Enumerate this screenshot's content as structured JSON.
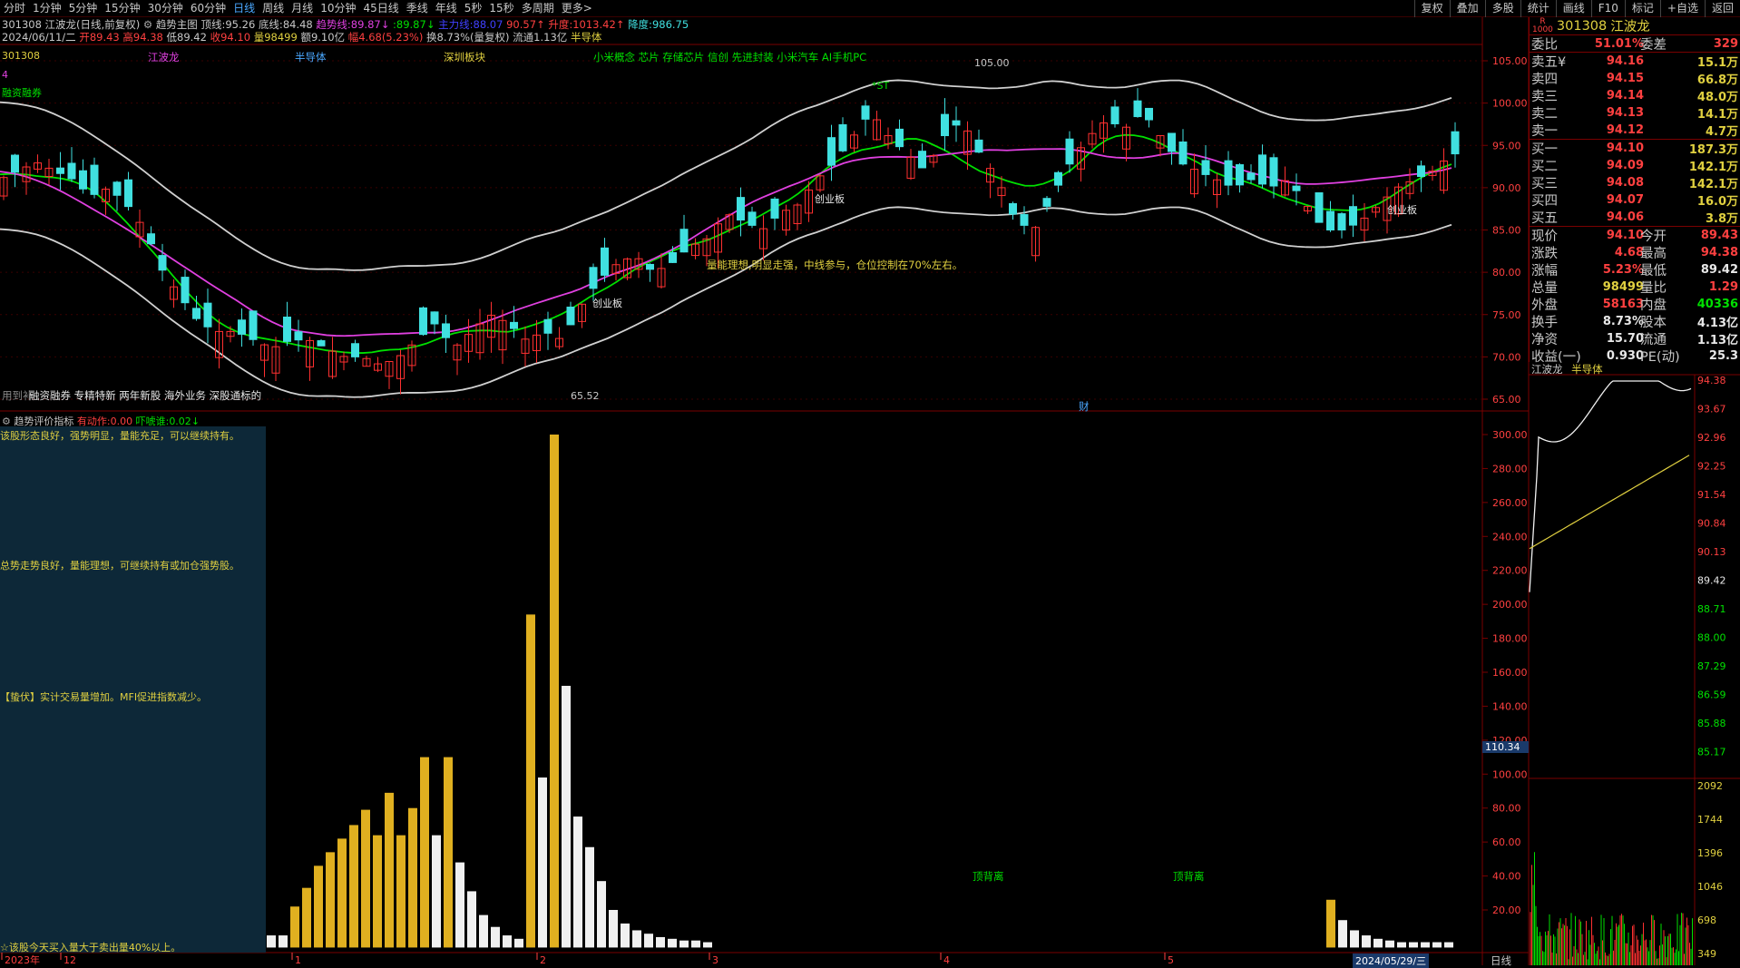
{
  "toolbar": {
    "periods": [
      "分时",
      "1分钟",
      "5分钟",
      "15分钟",
      "30分钟",
      "60分钟",
      "日线",
      "周线",
      "月线",
      "10分钟",
      "45日线",
      "季线",
      "年线",
      "5秒",
      "15秒",
      "多周期",
      "更多>"
    ],
    "active_period": "日线",
    "right_tools": [
      "复权",
      "叠加",
      "多股",
      "统计",
      "画线",
      "F10",
      "标记",
      "+自选",
      "返回"
    ]
  },
  "header": {
    "line1": {
      "code_name": "301308 江波龙(日线,前复权)",
      "indicator": "趋势主图",
      "top_label": "顶线:",
      "top_value": "95.26",
      "bottom_label": "底线:",
      "bottom_value": "84.48",
      "trend_label": "趋势线:",
      "trend_value": "89.87",
      "mid_label": ":",
      "mid_value": "89.87",
      "main_label": "主力线:",
      "main_value": "88.07",
      "price_value": "90.57",
      "rise_label": "升度:",
      "rise_value": "1013.42",
      "fall_label": "降度:",
      "fall_value": "986.75"
    },
    "line2": {
      "date": "2024/06/11/二",
      "open": "开89.43",
      "high": "高94.38",
      "low": "低89.42",
      "close": "收94.10",
      "vol": "量98499",
      "amount": "额9.10亿",
      "change": "幅4.68(5.23%)",
      "turnover": "换8.73%(量复权)",
      "float": "流通1.13亿",
      "sector": "半导体"
    }
  },
  "chart_labels": {
    "top_left_code": "301308",
    "marker4": "4",
    "rzrq": "融资融券",
    "stock_name_tag": "江波龙",
    "sector_tag": "半导体",
    "board_tag": "深圳板块",
    "concepts": "小米概念 芯片 存储芯片 信创 先进封装 小米汽车 AI手机PC",
    "bottom_concepts": "融资融券 专精特新 两年新股 海外业务 深股通标的",
    "bottom_prefix": "用到补",
    "wealth": "财",
    "chuangye1": "创业板",
    "chuangye2": "创业板",
    "chuangye3": "创业板",
    "st_label": "*ST",
    "note": "量能理想,明显走强，中线参与，仓位控制在70%左右。",
    "high_mark": "105.00",
    "low_mark": "65.52",
    "y_axis": [
      "105.00",
      "100.00",
      "95.00",
      "90.00",
      "85.00",
      "80.00",
      "75.00",
      "70.00",
      "65.00"
    ]
  },
  "sub_panel": {
    "title": "趋势评价指标",
    "power_label": "有动作:",
    "power_value": "0.00",
    "vol_label": "吓唬谁:",
    "vol_value": "0.02",
    "text1": "该股形态良好，强势明显，量能充足，可以继续持有。",
    "text2": "总势走势良好，量能理想，可继续持有或加仓强势股。",
    "text3": "【蛰伏】实计交易量增加。MFI促进指数减少。",
    "text4": "☆该股今天买入量大于卖出量40%以上。",
    "top_diverge1": "顶背离",
    "top_diverge2": "顶背离",
    "y_axis": [
      "300.00",
      "280.00",
      "260.00",
      "240.00",
      "220.00",
      "200.00",
      "180.00",
      "160.00",
      "140.00",
      "120.00",
      "100.00",
      "80.00",
      "60.00",
      "40.00",
      "20.00"
    ],
    "cursor_value": "110.34"
  },
  "x_axis": {
    "labels": [
      "2023年",
      "12",
      "1",
      "2",
      "3",
      "4",
      "5"
    ],
    "current_date": "2024/05/29/三",
    "period_label": "日线"
  },
  "quote": {
    "badge": "R",
    "badge_sub": "1000",
    "code": "301308",
    "name": "江波龙",
    "weibi_label": "委比",
    "weibi_value": "51.01%",
    "weicha_label": "委差",
    "weicha_value": "329",
    "asks": [
      {
        "label": "卖五¥",
        "price": "94.16",
        "vol": "15.1万"
      },
      {
        "label": "卖四",
        "price": "94.15",
        "vol": "66.8万"
      },
      {
        "label": "卖三",
        "price": "94.14",
        "vol": "48.0万"
      },
      {
        "label": "卖二",
        "price": "94.13",
        "vol": "14.1万"
      },
      {
        "label": "卖一",
        "price": "94.12",
        "vol": "4.7万"
      }
    ],
    "bids": [
      {
        "label": "买一",
        "price": "94.10",
        "vol": "187.3万"
      },
      {
        "label": "买二",
        "price": "94.09",
        "vol": "142.1万"
      },
      {
        "label": "买三",
        "price": "94.08",
        "vol": "142.1万"
      },
      {
        "label": "买四",
        "price": "94.07",
        "vol": "16.0万"
      },
      {
        "label": "买五",
        "price": "94.06",
        "vol": "3.8万"
      }
    ],
    "stats": [
      {
        "a": "现价",
        "av": "94.10",
        "b": "今开",
        "bv": "89.43",
        "ac": "red",
        "bc": "red"
      },
      {
        "a": "涨跌",
        "av": "4.68",
        "b": "最高",
        "bv": "94.38",
        "ac": "red",
        "bc": "red"
      },
      {
        "a": "涨幅",
        "av": "5.23%",
        "b": "最低",
        "bv": "89.42",
        "ac": "red",
        "bc": "white"
      },
      {
        "a": "总量",
        "av": "98499",
        "b": "量比",
        "bv": "1.29",
        "ac": "yellow",
        "bc": "red"
      },
      {
        "a": "外盘",
        "av": "58163",
        "b": "内盘",
        "bv": "40336",
        "ac": "red",
        "bc": "green"
      },
      {
        "a": "换手",
        "av": "8.73%",
        "b": "股本",
        "bv": "4.13亿",
        "ac": "white",
        "bc": "white"
      },
      {
        "a": "净资",
        "av": "15.70",
        "b": "流通",
        "bv": "1.13亿",
        "ac": "white",
        "bc": "white"
      },
      {
        "a": "收益(一)",
        "av": "0.930",
        "b": "PE(动)",
        "bv": "25.3",
        "ac": "white",
        "bc": "white"
      }
    ]
  },
  "intraday": {
    "name": "江波龙",
    "sector": "半导体",
    "price_axis": [
      "94.38",
      "93.67",
      "92.96",
      "92.25",
      "91.54",
      "90.84",
      "90.13",
      "89.42",
      "88.71",
      "88.00",
      "87.29",
      "86.59",
      "85.88",
      "85.17"
    ],
    "vol_axis": [
      "2092",
      "1744",
      "1396",
      "1046",
      "698",
      "349"
    ]
  },
  "colors": {
    "up": "#ff3030",
    "down": "#40e0e0",
    "trend": "#00e000",
    "main": "#e040e0",
    "band": "#d0d0d0",
    "gold": "#e0b020"
  }
}
